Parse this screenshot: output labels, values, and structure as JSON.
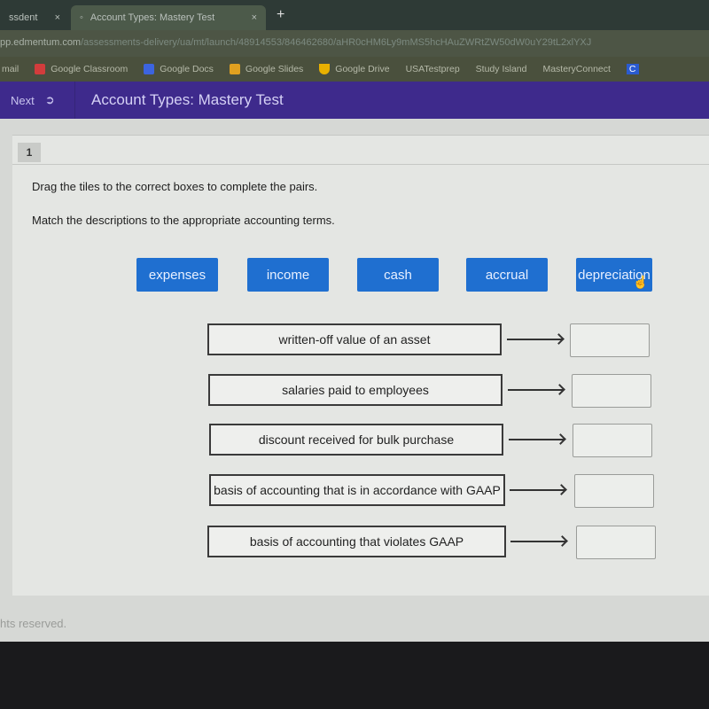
{
  "browser": {
    "tabs": [
      {
        "label": "ssdent"
      },
      {
        "label": "Account Types: Mastery Test",
        "active": true
      }
    ],
    "url_host": "pp.edmentum.com",
    "url_path": "/assessments-delivery/ua/mt/launch/48914553/846462680/aHR0cHM6Ly9mMS5hcHAuZWRtZW50dW0uY29tL2xlYXJ",
    "bookmarks": [
      {
        "label": "mail"
      },
      {
        "label": "Google Classroom",
        "color": "#d23c3c"
      },
      {
        "label": "Google Docs",
        "color": "#3c64e0"
      },
      {
        "label": "Google Slides",
        "color": "#e0a020"
      },
      {
        "label": "Google Drive",
        "color": "#e8b000"
      },
      {
        "label": "USATestprep"
      },
      {
        "label": "Study Island"
      },
      {
        "label": "MasteryConnect"
      },
      {
        "label": "C"
      }
    ]
  },
  "app": {
    "next_label": "Next",
    "title": "Account Types: Mastery Test"
  },
  "question": {
    "number": "1",
    "instruction1": "Drag the tiles to the correct boxes to complete the pairs.",
    "instruction2": "Match the descriptions to the appropriate accounting terms.",
    "tiles": [
      "expenses",
      "income",
      "cash",
      "accrual",
      "depreciation"
    ],
    "descriptions": [
      "written-off value of an asset",
      "salaries paid to employees",
      "discount received for bulk purchase",
      "basis of accounting that is in accordance with GAAP",
      "basis of accounting that violates GAAP"
    ]
  },
  "footer": "hts reserved.",
  "colors": {
    "tile": "#1f6fd0",
    "appbar": "#3e2a8c"
  }
}
